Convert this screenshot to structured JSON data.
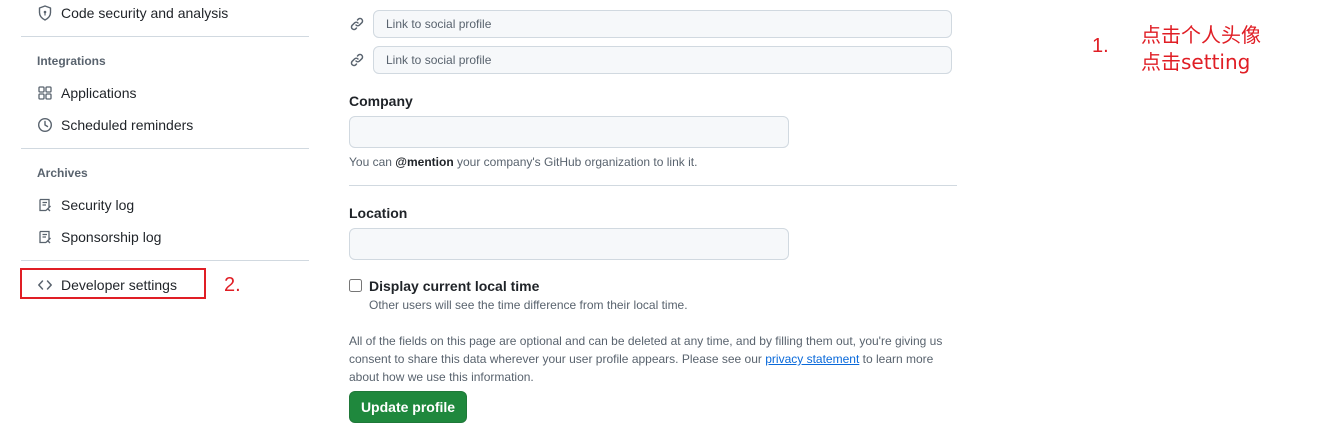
{
  "sidebar": {
    "code_security": "Code security and analysis",
    "integrations_heading": "Integrations",
    "applications": "Applications",
    "scheduled_reminders": "Scheduled reminders",
    "archives_heading": "Archives",
    "security_log": "Security log",
    "sponsorship_log": "Sponsorship log",
    "developer_settings": "Developer settings"
  },
  "social": {
    "placeholder_1": "Link to social profile",
    "placeholder_2": "Link to social profile"
  },
  "company": {
    "label": "Company",
    "value": "",
    "hint_prefix": "You can",
    "hint_mention": "@mention",
    "hint_suffix": "your company's GitHub organization to link it."
  },
  "location": {
    "label": "Location",
    "value": ""
  },
  "local_time": {
    "label": "Display current local time",
    "hint": "Other users will see the time difference from their local time.",
    "checked": false
  },
  "disclaimer": {
    "line1": "All of the fields on this page are optional and can be deleted at any time, and by filling them out, you're giving us",
    "line2_prefix": "consent to share this data wherever your user profile appears. Please see our",
    "privacy_link": "privacy statement",
    "line2_suffix": "to learn more",
    "line3": "about how we use this information."
  },
  "update_button": "Update profile",
  "annotations": {
    "step1_num": "1.",
    "step1_line1": "点击个人头像",
    "step1_line2": "点击setting",
    "step2_num": "2.",
    "color": "#e01e25"
  },
  "icons": {
    "code_security": "shield-icon",
    "applications": "apps-grid-icon",
    "scheduled_reminders": "clock-icon",
    "security_log": "log-icon",
    "sponsorship_log": "log-icon",
    "developer_settings": "code-icon",
    "social_link": "link-icon"
  }
}
